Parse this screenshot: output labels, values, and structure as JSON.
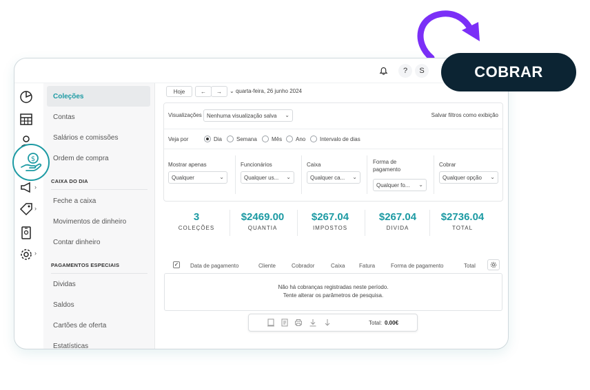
{
  "topbar": {
    "user_initial": "S"
  },
  "sidebar": {
    "items_top": [
      "Coleções",
      "Contas",
      "Salários e comissões",
      "Ordem de compra"
    ],
    "section_caixa": "CAIXA DO DIA",
    "items_caixa": [
      "Feche a caixa",
      "Movimentos de dinheiro",
      "Contar dinheiro"
    ],
    "section_pagamentos": "PAGAMENTOS ESPECIAIS",
    "items_pagamentos": [
      "Dividas",
      "Saldos",
      "Cartões de oferta",
      "Estatísticas"
    ]
  },
  "toolbar": {
    "today": "Hoje",
    "prev": "←",
    "next": "→",
    "date": "quarta-feira, 26 junho 2024"
  },
  "filters": {
    "views_label": "Visualizações",
    "views_value": "Nenhuma visualização salva",
    "save_filters": "Salvar filtros como exibição",
    "see_by_label": "Veja por",
    "periods": [
      "Dia",
      "Semana",
      "Mês",
      "Ano",
      "Intervalo de dias"
    ],
    "selected_period": "Dia",
    "show_only_label": "Mostrar apenas",
    "show_only_value": "Qualquer",
    "employees_label": "Funcionários",
    "employees_value": "Qualquer us...",
    "cash_label": "Caixa",
    "cash_value": "Qualquer ca...",
    "payment_label": "Forma de pagamento",
    "payment_value": "Qualquer fo...",
    "charge_label": "Cobrar",
    "charge_value": "Qualquer opção"
  },
  "stats": [
    {
      "value": "3",
      "label": "COLEÇÕES"
    },
    {
      "value": "$2469.00",
      "label": "QUANTIA"
    },
    {
      "value": "$267.04",
      "label": "IMPOSTOS"
    },
    {
      "value": "$267.04",
      "label": "DIVIDA"
    },
    {
      "value": "$2736.04",
      "label": "TOTAL"
    }
  ],
  "table": {
    "columns": [
      "Data de pagamento",
      "Cliente",
      "Cobrador",
      "Caixa",
      "Fatura",
      "Forma de pagamento",
      "Total"
    ],
    "empty_line1": "Não há cobranças registradas neste período.",
    "empty_line2": "Tente alterar os parâmetros de pesquisa."
  },
  "footer": {
    "total_label": "Total:",
    "total_value": "0.00€"
  },
  "cta": {
    "label": "COBRAR"
  },
  "colors": {
    "accent": "#1c9aa3",
    "arrow": "#7b2ff7",
    "cta_bg": "#0c2433"
  }
}
